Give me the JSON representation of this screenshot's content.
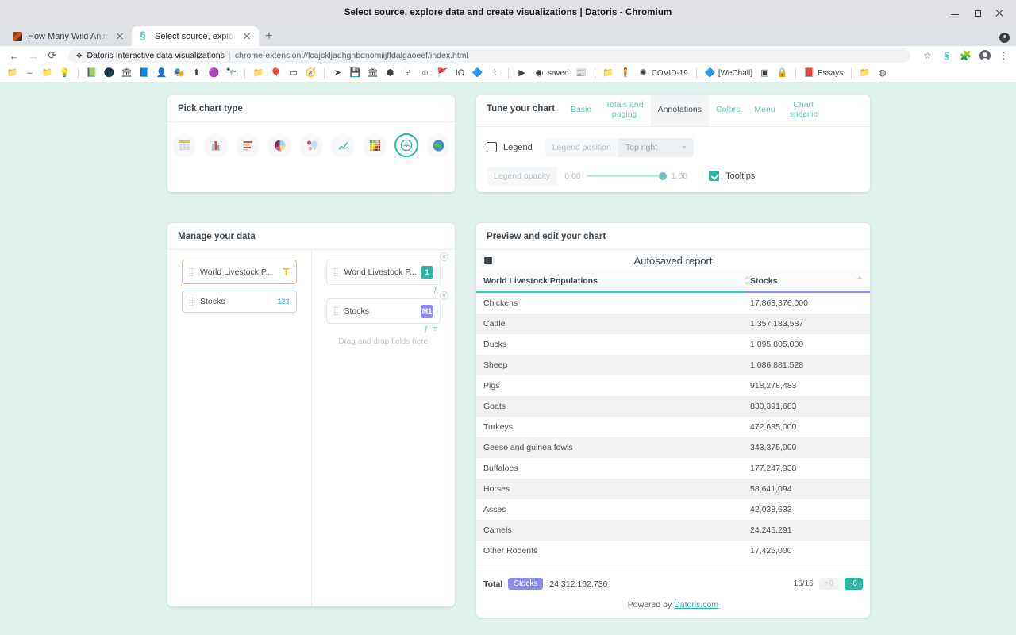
{
  "window": {
    "title": "Select source, explore data and create visualizations | Datoris - Chromium",
    "minimize": "–",
    "maximize": "□",
    "close": "✕"
  },
  "tabs": [
    {
      "title": "How Many Wild Animals Ar",
      "favicon": "wild-animals-favicon",
      "active": false
    },
    {
      "title": "Select source, explore data",
      "favicon": "datoris-favicon",
      "active": true
    }
  ],
  "newtab_label": "+",
  "toolbar": {
    "back": "←",
    "forward": "→",
    "reload": "⟳",
    "omnibox_site": "Datoris Interactive data visualizations",
    "omnibox_url": "chrome-extension://lcajckljadhgnbdnomiijffdalgaoeef/index.html",
    "lock_icon": "extension-icon",
    "star": "☆",
    "extension_icon": "datoris-extension-icon",
    "puzzle_icon": "extensions-puzzle-icon",
    "profile_icon": "profile-avatar-icon",
    "menu_icon": "⋮"
  },
  "bookmarks": [
    {
      "label": "",
      "icon": "folder-icon"
    },
    {
      "label": "",
      "icon": "dash-icon"
    },
    {
      "label": "",
      "icon": "folder-icon"
    },
    {
      "label": "",
      "icon": "lightbulb-icon"
    },
    {
      "sep": true
    },
    {
      "label": "",
      "icon": "green-book-icon"
    },
    {
      "label": "",
      "icon": "globe-dark-icon"
    },
    {
      "label": "",
      "icon": "building-icon"
    },
    {
      "label": "",
      "icon": "blue-doc-icon"
    },
    {
      "label": "",
      "icon": "blue-person-icon"
    },
    {
      "label": "",
      "icon": "red-mask-icon"
    },
    {
      "label": "",
      "icon": "upload-icon"
    },
    {
      "label": "",
      "icon": "purple-circle-icon"
    },
    {
      "label": "",
      "icon": "binoculars-icon"
    },
    {
      "sep": true
    },
    {
      "label": "",
      "icon": "folder-icon"
    },
    {
      "label": "",
      "icon": "purple-balloon-icon"
    },
    {
      "label": "",
      "icon": "grey-box-icon"
    },
    {
      "label": "",
      "icon": "orange-compass-icon"
    },
    {
      "sep": true
    },
    {
      "label": "",
      "icon": "blue-arrow-icon"
    },
    {
      "label": "",
      "icon": "save-disk-icon"
    },
    {
      "label": "",
      "icon": "building-icon"
    },
    {
      "label": "",
      "icon": "dark-sphere-icon"
    },
    {
      "label": "",
      "icon": "sitemap-icon"
    },
    {
      "label": "",
      "icon": "teal-face-icon"
    },
    {
      "label": "",
      "icon": "red-flag-icon"
    },
    {
      "label": "",
      "icon": "io-icon"
    },
    {
      "label": "",
      "icon": "blue-square-icon"
    },
    {
      "label": "",
      "icon": "blue-hook-icon"
    },
    {
      "sep": true
    },
    {
      "label": "",
      "icon": "youtube-icon"
    },
    {
      "label": "saved",
      "icon": "reddit-icon"
    },
    {
      "label": "",
      "icon": "news-icon"
    },
    {
      "sep": true
    },
    {
      "label": "",
      "icon": "folder-icon"
    },
    {
      "label": "",
      "icon": "person-photo-icon"
    },
    {
      "label": "COVID-19",
      "icon": "virus-icon"
    },
    {
      "sep": true
    },
    {
      "label": "[WeChall]",
      "icon": "wechall-icon"
    },
    {
      "label": "",
      "icon": "image-placeholder-icon"
    },
    {
      "label": "",
      "icon": "lock-icon"
    },
    {
      "sep": true
    },
    {
      "label": "Essays",
      "icon": "essays-icon"
    },
    {
      "sep": true
    },
    {
      "label": "",
      "icon": "folder-icon"
    },
    {
      "label": "",
      "icon": "grey-globe-icon"
    }
  ],
  "pick_chart": {
    "title": "Pick chart type",
    "types": [
      {
        "name": "table-chart",
        "selected": false
      },
      {
        "name": "column-chart",
        "selected": false
      },
      {
        "name": "bar-chart",
        "selected": false
      },
      {
        "name": "pie-chart",
        "selected": false
      },
      {
        "name": "bubble-chart",
        "selected": false
      },
      {
        "name": "line-chart",
        "selected": false
      },
      {
        "name": "heatmap-chart",
        "selected": false
      },
      {
        "name": "gauge-chart",
        "selected": true
      },
      {
        "name": "map-chart",
        "selected": false
      }
    ]
  },
  "tune": {
    "title": "Tune your chart",
    "tabs": [
      {
        "label": "Basic",
        "active": false
      },
      {
        "label": "Totals and\npaging",
        "active": false
      },
      {
        "label": "Annotations",
        "active": true
      },
      {
        "label": "Colors",
        "active": false
      },
      {
        "label": "Menu",
        "active": false
      },
      {
        "label": "Chart\nspecific",
        "active": false
      }
    ],
    "legend_label": "Legend",
    "legend_checked": false,
    "legend_position_label": "Legend position",
    "legend_position_value": "Top right",
    "legend_opacity_label": "Legend opacity",
    "opacity_min": "0.00",
    "opacity_max": "1.00",
    "tooltips_label": "Tooltips",
    "tooltips_checked": true
  },
  "manage": {
    "title": "Manage your data",
    "source_fields": [
      {
        "label": "World Livestock P...",
        "type_glyph": "T",
        "type": "text",
        "selected": "amber"
      },
      {
        "label": "Stocks",
        "type_glyph": "123",
        "type": "number",
        "selected": "blue"
      }
    ],
    "used_fields": [
      {
        "label": "World Livestock P...",
        "badge": "1",
        "badge_color": "teal",
        "sub": "ƒ"
      },
      {
        "label": "Stocks",
        "badge": "M1",
        "badge_color": "purple",
        "sub": "ƒ #"
      }
    ],
    "drop_hint": "Drag and drop fields here"
  },
  "preview": {
    "title": "Preview and edit your chart",
    "report_title": "Autosaved report",
    "total_label": "Total",
    "total_chip": "Stocks",
    "total_value": "24,312,162,736",
    "page_count": "16/16",
    "page_plus": "+0",
    "page_minus": "-6",
    "powered_text": "Powered by ",
    "powered_link": "Datoris.com"
  },
  "chart_data": {
    "type": "table",
    "title": "Autosaved report",
    "columns": [
      "World Livestock Populations",
      "Stocks"
    ],
    "categories": [
      "Chickens",
      "Cattle",
      "Ducks",
      "Sheep",
      "Pigs",
      "Goats",
      "Turkeys",
      "Geese and guinea fowls",
      "Buffaloes",
      "Horses",
      "Asses",
      "Camels",
      "Other Rodents"
    ],
    "values": [
      17863376000,
      1357183587,
      1095805000,
      1086881528,
      918278483,
      830391683,
      472635000,
      343375000,
      177247938,
      58641094,
      42038633,
      24246291,
      17425000
    ],
    "values_formatted": [
      "17,863,376,000",
      "1,357,183,587",
      "1,095,805,000",
      "1,086,881,528",
      "918,278,483",
      "830,391,683",
      "472,635,000",
      "343,375,000",
      "177,247,938",
      "58,641,094",
      "42,038,633",
      "24,246,291",
      "17,425,000"
    ],
    "rows": [
      {
        "label": "Chickens",
        "value": "17,863,376,000"
      },
      {
        "label": "Cattle",
        "value": "1,357,183,587"
      },
      {
        "label": "Ducks",
        "value": "1,095,805,000"
      },
      {
        "label": "Sheep",
        "value": "1,086,881,528"
      },
      {
        "label": "Pigs",
        "value": "918,278,483"
      },
      {
        "label": "Goats",
        "value": "830,391,683"
      },
      {
        "label": "Turkeys",
        "value": "472,635,000"
      },
      {
        "label": "Geese and guinea fowls",
        "value": "343,375,000"
      },
      {
        "label": "Buffaloes",
        "value": "177,247,938"
      },
      {
        "label": "Horses",
        "value": "58,641,094"
      },
      {
        "label": "Asses",
        "value": "42,038,633"
      },
      {
        "label": "Camels",
        "value": "24,246,291"
      },
      {
        "label": "Other Rodents",
        "value": "17,425,000"
      }
    ],
    "total": "24,312,162,736",
    "xlabel": "",
    "ylabel": "Stocks",
    "legend": false,
    "grid": false
  },
  "colors": {
    "accent_teal": "#2fb5a3",
    "accent_purple": "#8b8de8",
    "amber": "#f2c14e",
    "page_bg": "#dff0ed"
  }
}
